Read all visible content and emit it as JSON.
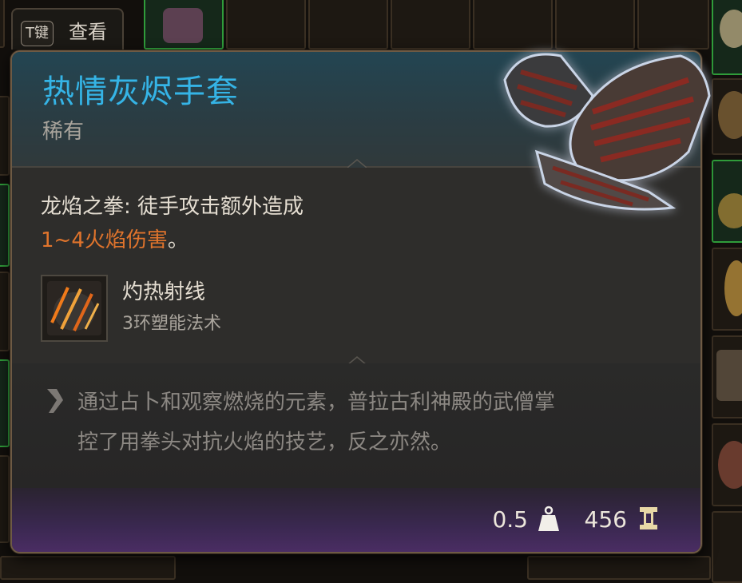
{
  "inventory_hint": {
    "key": "T键",
    "label": "查看"
  },
  "item": {
    "name": "热情灰烬手套",
    "rarity": "稀有",
    "effect_line1": "龙焰之拳: 徒手攻击额外造成",
    "effect_damage": "1~4火焰伤害",
    "effect_end": "。",
    "spell": {
      "name": "灼热射线",
      "level": "3环塑能法术",
      "icon": "scorching-ray-icon"
    },
    "lore_line1": "通过占卜和观察燃烧的元素，普拉古利神殿的武僧掌",
    "lore_line2": "控了用拳头对抗火焰的技艺，反之亦然。",
    "weight": "0.5",
    "value": "456"
  },
  "colors": {
    "title": "#35b4e6",
    "damage": "#e0742c",
    "slot_highlight": "#2f9c3a"
  }
}
